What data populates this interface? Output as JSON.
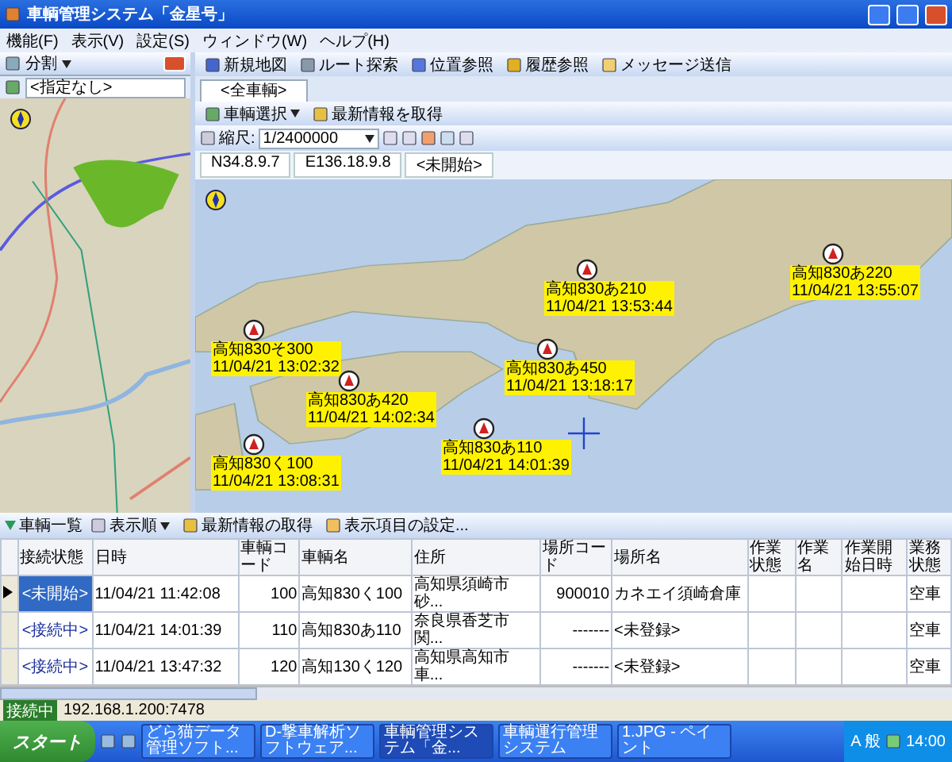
{
  "window": {
    "title": "車輌管理システム「金星号」"
  },
  "menu": [
    "機能(F)",
    "表示(V)",
    "設定(S)",
    "ウィンドウ(W)",
    "ヘルプ(H)"
  ],
  "left_panel": {
    "title": "分割",
    "filter": "<指定なし>"
  },
  "toolbar": [
    "新規地図",
    "ルート探索",
    "位置参照",
    "履歴参照",
    "メッセージ送信"
  ],
  "tabs": [
    {
      "label": "<全車輌>",
      "selected": true
    }
  ],
  "map_toolbar": {
    "vehicle_select": "車輌選択",
    "refresh": "最新情報を取得",
    "scale_label": "縮尺:",
    "scale": "1/2400000"
  },
  "coordinates": {
    "latitude": "N34.8.9.7",
    "longitude": "E136.18.9.8",
    "status": "<未開始>"
  },
  "vehicles": [
    {
      "name": "高知830そ300",
      "time": "11/04/21 13:02:32"
    },
    {
      "name": "高知830あ420",
      "time": "11/04/21 14:02:34"
    },
    {
      "name": "高知830く100",
      "time": "11/04/21 13:08:31"
    },
    {
      "name": "高知830あ110",
      "time": "11/04/21 14:01:39"
    },
    {
      "name": "高知830あ450",
      "time": "11/04/21 13:18:17"
    },
    {
      "name": "高知830あ210",
      "time": "11/04/21 13:53:44"
    },
    {
      "name": "高知830あ220",
      "time": "11/04/21 13:55:07"
    }
  ],
  "list_panel": {
    "title": "車輌一覧",
    "sort": "表示順",
    "refresh": "最新情報の取得",
    "settings": "表示項目の設定..."
  },
  "table": {
    "columns": [
      "接続状態",
      "日時",
      "車輌コード",
      "車輌名",
      "住所",
      "場所コード",
      "場所名",
      "作業状態",
      "作業名",
      "作業開始日時",
      "業務状態"
    ],
    "rows": [
      {
        "selected": true,
        "cells": [
          "<未開始>",
          "11/04/21 11:42:08",
          "100",
          "高知830く100",
          "高知県須崎市砂...",
          "900010",
          "カネエイ須崎倉庫",
          "",
          "",
          "",
          "空車"
        ]
      },
      {
        "selected": false,
        "cells": [
          "<接続中>",
          "11/04/21 14:01:39",
          "110",
          "高知830あ110",
          "奈良県香芝市関...",
          "-------",
          "<未登録>",
          "",
          "",
          "",
          "空車"
        ]
      },
      {
        "selected": false,
        "cells": [
          "<接続中>",
          "11/04/21 13:47:32",
          "120",
          "高知130く120",
          "高知県高知市車...",
          "-------",
          "<未登録>",
          "",
          "",
          "",
          "空車"
        ]
      }
    ]
  },
  "status_bar": {
    "state": "接続中",
    "address": "192.168.1.200:7478"
  },
  "taskbar": {
    "start": "スタート",
    "items": [
      {
        "label": "どら猫データ管理ソフト...",
        "selected": false
      },
      {
        "label": "D-撃車解析ソフトウェア...",
        "selected": false
      },
      {
        "label": "車輌管理システム「金...",
        "selected": true
      },
      {
        "label": "車輌運行管理システム",
        "selected": false
      },
      {
        "label": "1.JPG - ペイント",
        "selected": false
      }
    ],
    "ime": "A 般",
    "clock": "14:00"
  }
}
